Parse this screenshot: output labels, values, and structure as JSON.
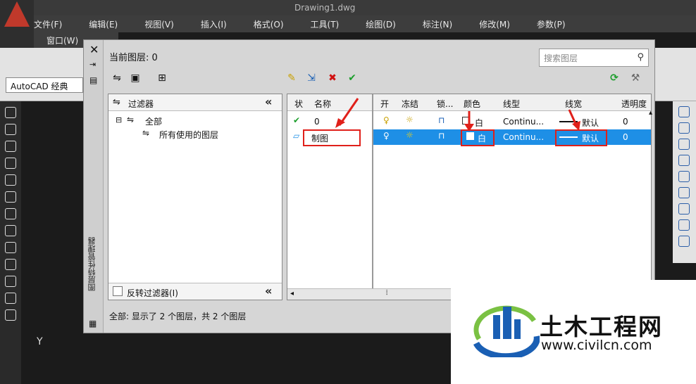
{
  "app": {
    "title_fragment": "Drawing1.dwg"
  },
  "menu": [
    "文件(F)",
    "编辑(E)",
    "视图(V)",
    "插入(I)",
    "格式(O)",
    "工具(T)",
    "绘图(D)",
    "标注(N)",
    "修改(M)",
    "参数(P)"
  ],
  "menu2": [
    "窗口(W)"
  ],
  "workspace": "AutoCAD 经典",
  "palette": {
    "side_title": "图层特性管理器",
    "current_layer": "当前图层: 0",
    "search_placeholder": "搜索图层",
    "filter_header": "过滤器",
    "tree_all": "全部",
    "tree_used": "所有使用的图层",
    "invert_filter": "反转过滤器(I)",
    "status": "全部: 显示了 2 个图层，共 2 个图层",
    "columns": [
      "状",
      "名称",
      "开",
      "冻结",
      "锁...",
      "颜色",
      "线型",
      "线宽",
      "透明度"
    ],
    "rows": [
      {
        "status": "✔",
        "name": "0",
        "on": "bulb",
        "freeze": "sun",
        "lock": "unlock",
        "color": "白",
        "linetype": "Continu...",
        "lineweight": "默认",
        "transparency": "0"
      },
      {
        "status": "▱",
        "name": "制图",
        "on": "bulb",
        "freeze": "sun",
        "lock": "unlock",
        "color": "白",
        "linetype": "Continu...",
        "lineweight": "默认",
        "transparency": "0"
      }
    ],
    "selected_row": 1
  },
  "watermark": {
    "brand": "土木工程网",
    "url": "www.civilcn.com"
  },
  "drawing": {
    "y_axis": "Y"
  },
  "colors": {
    "selection": "#1e8fe6",
    "annotation": "#e0201a",
    "brand_blue": "#1a5fb4",
    "brand_green": "#7ac143"
  }
}
